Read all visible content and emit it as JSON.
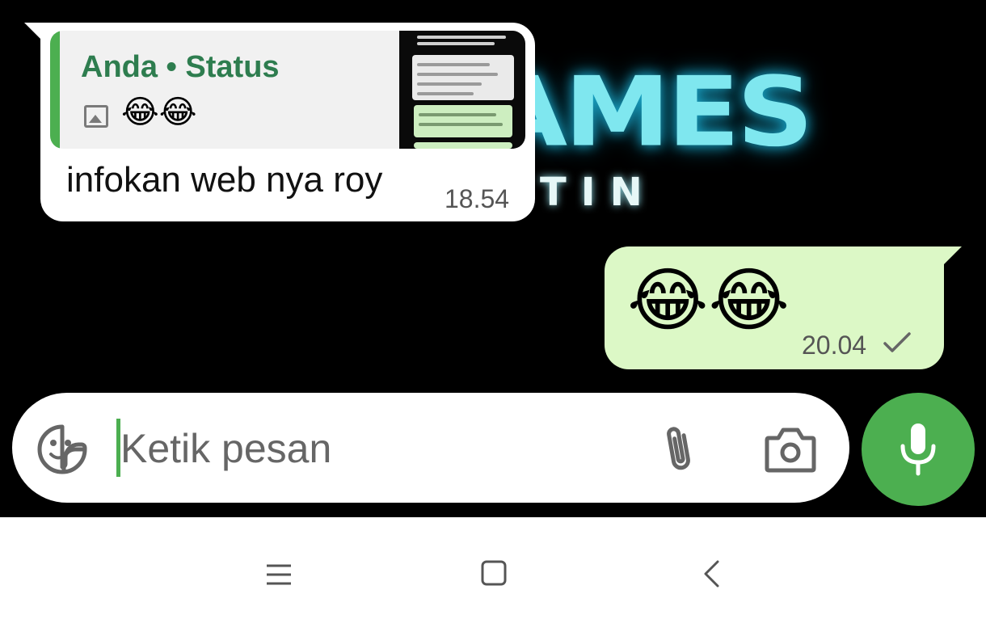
{
  "wallpaper": {
    "big_text": "AMES",
    "small_text": "TIN"
  },
  "incoming_message": {
    "reply_author": "Anda • Status",
    "reply_media_icon": "image-icon",
    "reply_emoji": "😂😂",
    "text": "infokan web nya roy",
    "time": "18.54"
  },
  "outgoing_message": {
    "emoji": "😂😂",
    "time": "20.04",
    "status_icon": "check-icon"
  },
  "composer": {
    "placeholder": "Ketik pesan",
    "sticker_icon": "sticker-icon",
    "attach_icon": "paperclip-icon",
    "camera_icon": "camera-icon",
    "mic_icon": "microphone-icon"
  },
  "navigation": {
    "recents_icon": "menu-icon",
    "home_icon": "home-square-icon",
    "back_icon": "back-chevron-icon"
  },
  "colors": {
    "accent_green": "#4caf50",
    "author_green": "#2e7d4f",
    "outgoing_bubble": "#dcf8c6",
    "incoming_bubble": "#ffffff",
    "chat_background": "#000000",
    "wallpaper_glow": "#7fe7ef"
  }
}
